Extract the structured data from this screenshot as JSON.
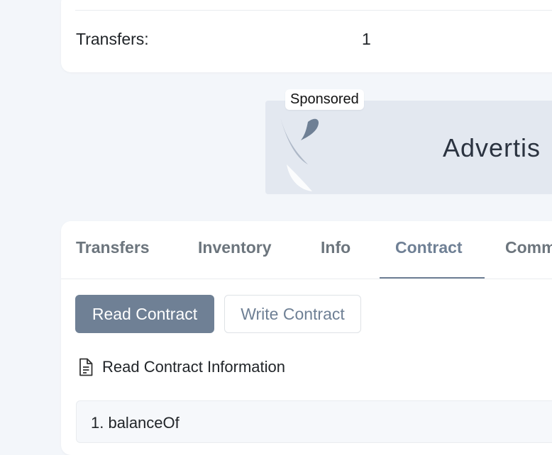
{
  "overview": {
    "transfers_label": "Transfers:",
    "transfers_value": "1"
  },
  "ad": {
    "sponsored_label": "Sponsored",
    "text": "Advertis"
  },
  "tabs": [
    {
      "label": "Transfers"
    },
    {
      "label": "Inventory"
    },
    {
      "label": "Info"
    },
    {
      "label": "Contract",
      "active": true
    },
    {
      "label": "Comm"
    }
  ],
  "contract": {
    "read_button": "Read Contract",
    "write_button": "Write Contract",
    "info_heading": "Read Contract Information",
    "functions": [
      {
        "title": "1. balanceOf"
      }
    ]
  },
  "colors": {
    "accent": "#6f8095",
    "background": "#f3f6fa",
    "card": "#ffffff"
  },
  "icons": {
    "info_heading_icon": "document-icon"
  }
}
